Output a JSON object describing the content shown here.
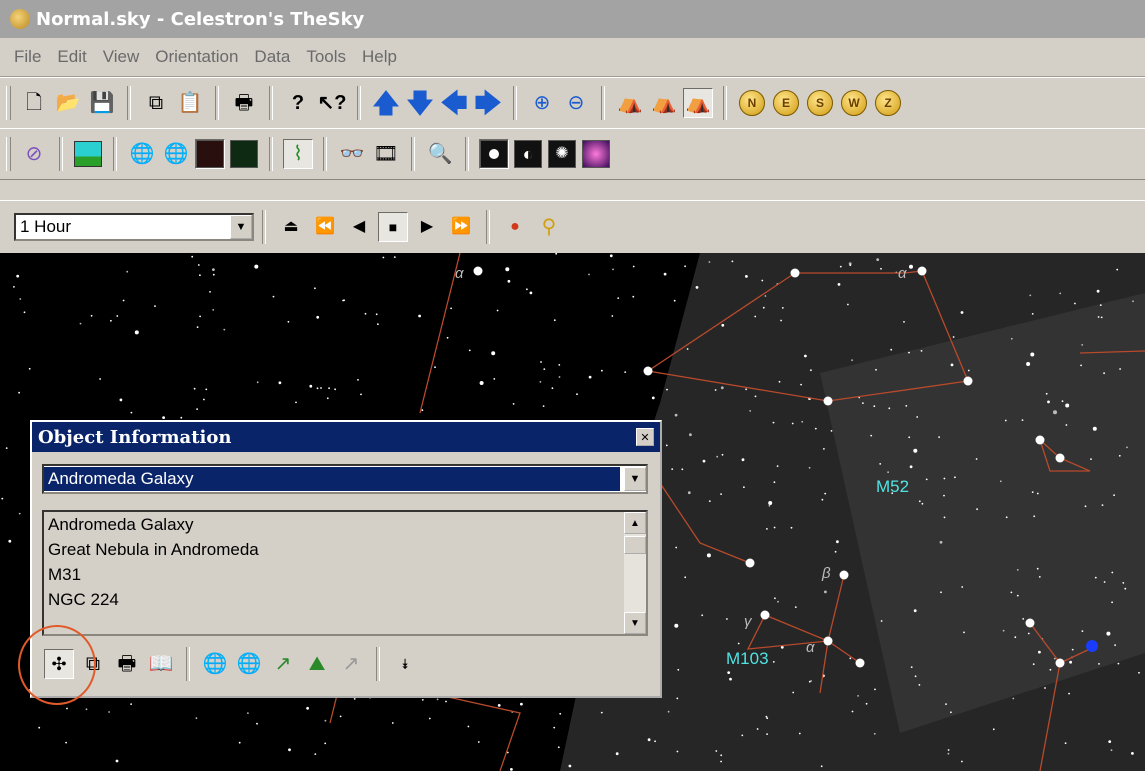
{
  "window": {
    "title": "Normal.sky - Celestron's TheSky"
  },
  "menu": [
    "File",
    "Edit",
    "View",
    "Orientation",
    "Data",
    "Tools",
    "Help"
  ],
  "toolbar3": {
    "time_step": "1 Hour"
  },
  "sky": {
    "labels": {
      "m52": "M52",
      "m103": "M103"
    },
    "greek": {
      "alpha1": "α",
      "alpha2": "α",
      "beta": "β",
      "gamma": "γ",
      "alpha3": "α"
    }
  },
  "object_info": {
    "title": "Object Information",
    "selected": "Andromeda Galaxy",
    "names": [
      "Andromeda Galaxy",
      "Great Nebula in Andromeda",
      "M31",
      "NGC 224"
    ]
  },
  "colors": {
    "accent": "#0a246a",
    "highlight_ring": "#e05a2a",
    "label": "#4fe3e3"
  }
}
